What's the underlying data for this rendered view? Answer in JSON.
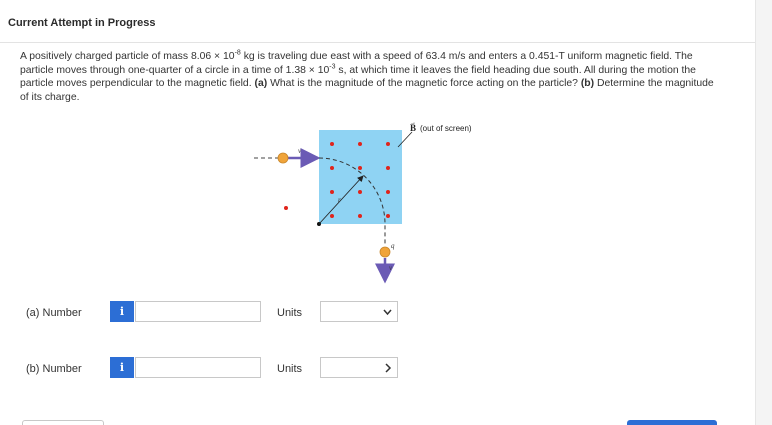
{
  "header": {
    "title": "Current Attempt in Progress"
  },
  "problem": {
    "p1": "A positively charged particle of mass 8.06 × 10",
    "p1_exp": "-8",
    "p2": " kg is traveling due east with a speed of 63.4 m/s and enters a 0.451-T uniform magnetic field. The particle moves through one-quarter of a circle in a time of 1.38 × 10",
    "p2_exp": "-3",
    "p3": " s, at which time it leaves the field heading due south. All during the motion the particle moves perpendicular to the magnetic field. ",
    "part_a_tag": "(a)",
    "part_a_text": " What is the magnitude of the magnetic force acting on the particle? ",
    "part_b_tag": "(b)",
    "part_b_text": " Determine the magnitude of its charge."
  },
  "figure": {
    "b_label": "B",
    "b_caption": "(out of screen)",
    "v_label_top": "v",
    "r_label": "r",
    "q_label": "q",
    "v_label_bottom": "v"
  },
  "answers": [
    {
      "label": "(a)  Number",
      "info": "i",
      "value": "",
      "units_label": "Units",
      "units_value": ""
    },
    {
      "label": "(b)  Number",
      "info": "i",
      "value": "",
      "units_label": "Units",
      "units_value": ""
    }
  ],
  "colors": {
    "accent": "#2c6ed5",
    "field": "#8fd3f3",
    "particle": "#f0a43a",
    "arrow": "#6b5bb5",
    "dot": "#e0241b"
  }
}
